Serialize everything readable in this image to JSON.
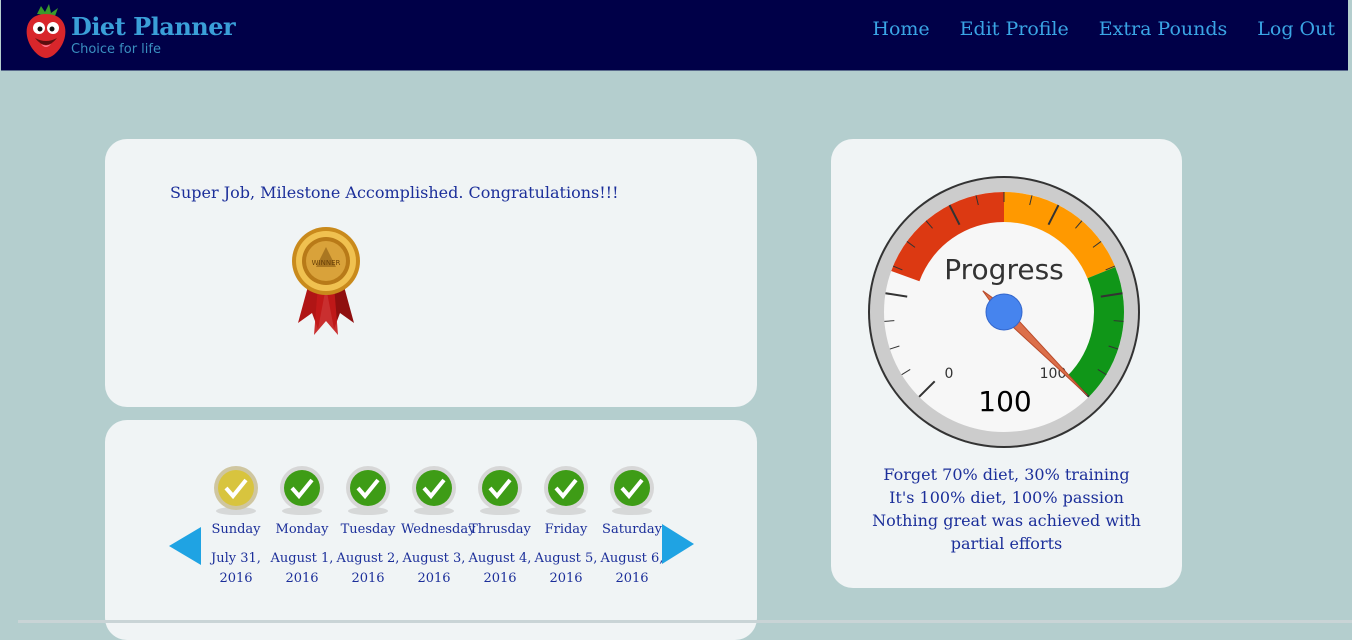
{
  "header": {
    "brand_title": "Diet Planner",
    "brand_subtitle": "Choice for life",
    "nav": [
      {
        "label": "Home"
      },
      {
        "label": "Edit Profile"
      },
      {
        "label": "Extra Pounds"
      },
      {
        "label": "Log Out"
      }
    ]
  },
  "milestone": {
    "message": "Super Job, Milestone Accomplished. Congratulations!!!",
    "medal_text": "WINNER"
  },
  "week": {
    "days": [
      {
        "name": "Sunday",
        "date": "July 31, 2016",
        "status": "current"
      },
      {
        "name": "Monday",
        "date": "August 1, 2016",
        "status": "done"
      },
      {
        "name": "Tuesday",
        "date": "August 2, 2016",
        "status": "done"
      },
      {
        "name": "Wednesday",
        "date": "August 3, 2016",
        "status": "done"
      },
      {
        "name": "Thrusday",
        "date": "August 4, 2016",
        "status": "done"
      },
      {
        "name": "Friday",
        "date": "August 5, 2016",
        "status": "done"
      },
      {
        "name": "Saturday",
        "date": "August 6, 2016",
        "status": "done"
      }
    ]
  },
  "progress": {
    "gauge_label": "Progress",
    "value": 100,
    "min_label": "0",
    "max_label": "100",
    "quote_lines": [
      "Forget 70% diet, 30% training",
      "It's 100% diet, 100% passion",
      "Nothing great was achieved with partial efforts"
    ]
  },
  "colors": {
    "nav_bg": "#000048",
    "page_bg": "#b4cece",
    "card_bg": "#f0f4f5",
    "text_blue": "#1c2f9a",
    "link_blue": "#3aa5e5",
    "gauge_red": "#dc3912",
    "gauge_orange": "#ff9900",
    "gauge_green": "#109618",
    "needle_hub": "#4684ee"
  },
  "icons": [
    "strawberry-logo-icon",
    "winner-medal-icon",
    "checkmark-icon",
    "arrow-left-icon",
    "arrow-right-icon"
  ]
}
